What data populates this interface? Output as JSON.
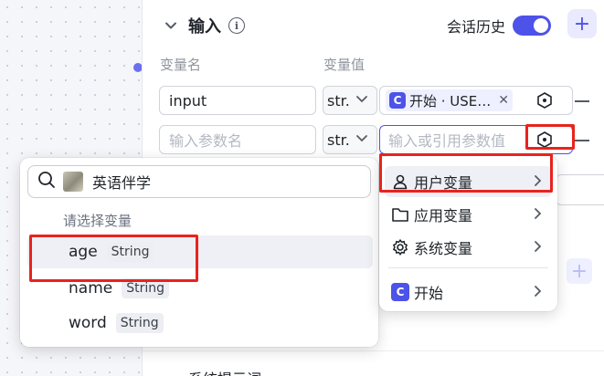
{
  "section": {
    "title": "输入",
    "history_label": "会话历史",
    "history_on": true
  },
  "columns": {
    "name": "变量名",
    "value": "变量值"
  },
  "rows": [
    {
      "name": "input",
      "type": "str.",
      "ref_label": "开始 · USE…"
    },
    {
      "name_placeholder": "输入参数名",
      "type": "str.",
      "value_placeholder": "输入或引用参数值"
    }
  ],
  "bottom_text": "系统提示词",
  "popup": {
    "search_value": "英语伴学",
    "section_label": "请选择变量",
    "variables": [
      {
        "name": "age",
        "type": "String"
      },
      {
        "name": "name",
        "type": "String"
      },
      {
        "name": "word",
        "type": "String"
      }
    ]
  },
  "menu": {
    "items": [
      {
        "label": "用户变量",
        "icon": "user-icon"
      },
      {
        "label": "应用变量",
        "icon": "folder-icon"
      },
      {
        "label": "系统变量",
        "icon": "gear-icon"
      },
      {
        "label": "开始",
        "icon": "start-node-icon"
      }
    ]
  },
  "colors": {
    "accent": "#4d53e8",
    "highlight_red": "#e8231d"
  }
}
